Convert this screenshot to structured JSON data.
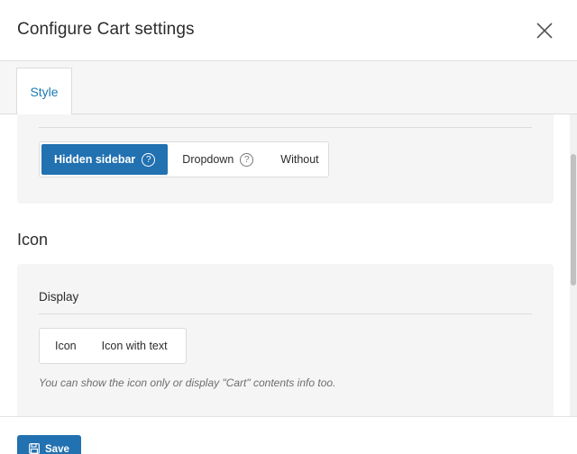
{
  "header": {
    "title": "Configure Cart settings",
    "close_icon": "close-icon"
  },
  "tabs": [
    {
      "label": "Style",
      "active": true
    }
  ],
  "style_section": {
    "layout_options": [
      {
        "label": "Hidden sidebar",
        "help": "?",
        "active": true
      },
      {
        "label": "Dropdown",
        "help": "?",
        "active": false
      },
      {
        "label": "Without",
        "active": false
      }
    ]
  },
  "icon_section": {
    "title": "Icon",
    "display_label": "Display",
    "display_options": [
      {
        "label": "Icon",
        "active": false
      },
      {
        "label": "Icon with text",
        "active": false
      }
    ],
    "hint": "You can show the icon only or display \"Cart\" contents info too."
  },
  "footer": {
    "save_label": "Save",
    "save_icon": "floppy-disk-icon"
  },
  "colors": {
    "accent": "#2271b1",
    "tab_text": "#1a7ab5",
    "panel_bg": "#f5f5f5"
  }
}
